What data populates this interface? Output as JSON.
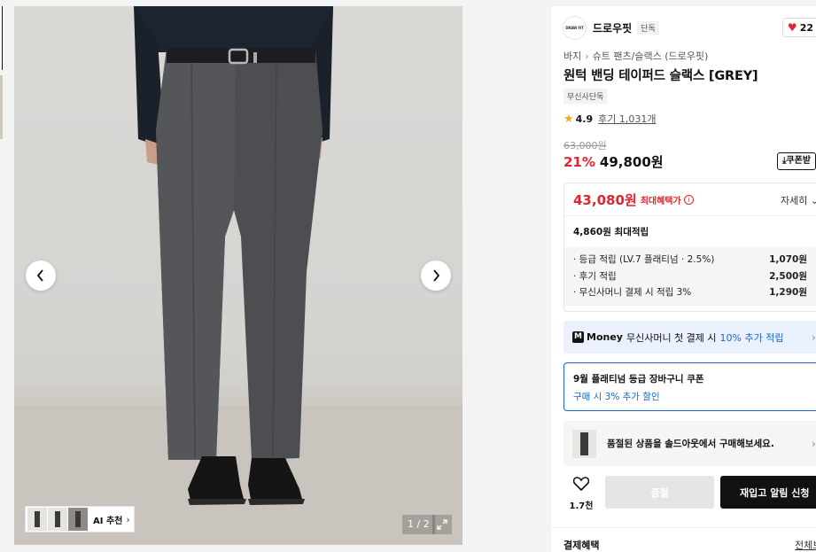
{
  "gallery": {
    "counter": "1 / 2",
    "ai_chip_label": "AI 추천",
    "prev_icon": "chevron-left-icon",
    "next_icon": "chevron-right-icon",
    "expand_icon": "expand-icon"
  },
  "brand": {
    "logo_text": "DRAW FIT",
    "name": "드로우핏",
    "solo_tag": "단독",
    "like_count": "22"
  },
  "breadcrumb": {
    "level1": "바지",
    "level2": "슈트 팬츠/슬랙스 (드로우핏)"
  },
  "product": {
    "title": "원턱 밴딩 테이퍼드 슬랙스 [GREY]",
    "exclusive_tag": "무신사단독",
    "rating": "4.9",
    "review_label": "후기 1,031개",
    "original_price": "63,000원",
    "discount": "21%",
    "price": "49,800원",
    "coupon_button": "쿠폰받"
  },
  "benefit": {
    "max_price": "43,080원",
    "max_label": "최대혜택가",
    "detail_label": "자세히",
    "points_total": "4,860원 최대적립",
    "rows": [
      {
        "label": "· 등급 적립 (LV.7 플래티넘 · 2.5%)",
        "amount": "1,070원"
      },
      {
        "label": "· 후기 적립",
        "amount": "2,500원"
      },
      {
        "label": "· 무신사머니 결제 시 적립 3%",
        "amount": "1,290원"
      }
    ]
  },
  "money_banner": {
    "logo": "M",
    "brand": "Money",
    "text": "무신사머니 첫 결제 시",
    "highlight": "10% 추가 적립"
  },
  "coupon_card": {
    "line1": "9월 플래티넘 등급 장바구니 쿠폰",
    "line2": "구매 시 3% 추가 할인"
  },
  "soldout_banner": {
    "text": "품절된 상품을 솔드아웃에서 구매해보세요."
  },
  "actions": {
    "wish_count": "1.7천",
    "soldout_button": "품절",
    "restock_button": "재입고 알림 신청"
  },
  "payment": {
    "heading": "결제혜택",
    "view_all": "전체보"
  },
  "colors": {
    "sale_red": "#e2262f",
    "accent_blue": "#1766d3",
    "dark": "#111111"
  }
}
